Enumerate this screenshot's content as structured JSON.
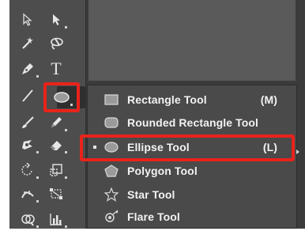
{
  "app": {
    "colors": {
      "toolbar": "#4d4d4d",
      "menu": "#4a4a4a",
      "highlight_red": "#e8231b",
      "text": "#f2f2f2"
    }
  },
  "toolbar": {
    "tools": [
      {
        "name": "selection-tool",
        "icon": "hollow-arrow-icon"
      },
      {
        "name": "direct-selection-tool",
        "icon": "solid-arrow-icon"
      },
      {
        "name": "magic-wand-tool",
        "icon": "magic-wand-icon"
      },
      {
        "name": "lasso-tool",
        "icon": "lasso-icon"
      },
      {
        "name": "pen-tool",
        "icon": "pen-icon"
      },
      {
        "name": "type-tool",
        "icon": "type-icon",
        "glyph": "T"
      },
      {
        "name": "line-segment-tool",
        "icon": "line-icon"
      },
      {
        "name": "ellipse-tool",
        "icon": "ellipse-icon",
        "selected": true
      },
      {
        "name": "paintbrush-tool",
        "icon": "paintbrush-icon"
      },
      {
        "name": "pencil-tool",
        "icon": "pencil-icon"
      },
      {
        "name": "shaper-tool",
        "icon": "shaper-icon"
      },
      {
        "name": "eraser-tool",
        "icon": "eraser-icon"
      },
      {
        "name": "rotate-tool",
        "icon": "rotate-icon"
      },
      {
        "name": "scale-tool",
        "icon": "scale-icon"
      },
      {
        "name": "width-tool",
        "icon": "width-icon"
      },
      {
        "name": "free-transform-tool",
        "icon": "free-transform-icon"
      },
      {
        "name": "shape-builder-tool",
        "icon": "shape-builder-icon"
      },
      {
        "name": "graph-tool",
        "icon": "graph-icon"
      }
    ]
  },
  "flyout": {
    "items": [
      {
        "label": "Rectangle Tool",
        "shortcut": "(M)",
        "icon": "rectangle-icon",
        "active": false
      },
      {
        "label": "Rounded Rectangle Tool",
        "shortcut": "",
        "icon": "rounded-rectangle-icon",
        "active": false
      },
      {
        "label": "Ellipse Tool",
        "shortcut": "(L)",
        "icon": "ellipse-icon",
        "active": true
      },
      {
        "label": "Polygon Tool",
        "shortcut": "",
        "icon": "polygon-icon",
        "active": false
      },
      {
        "label": "Star Tool",
        "shortcut": "",
        "icon": "star-icon",
        "active": false
      },
      {
        "label": "Flare Tool",
        "shortcut": "",
        "icon": "flare-icon",
        "active": false
      }
    ]
  }
}
